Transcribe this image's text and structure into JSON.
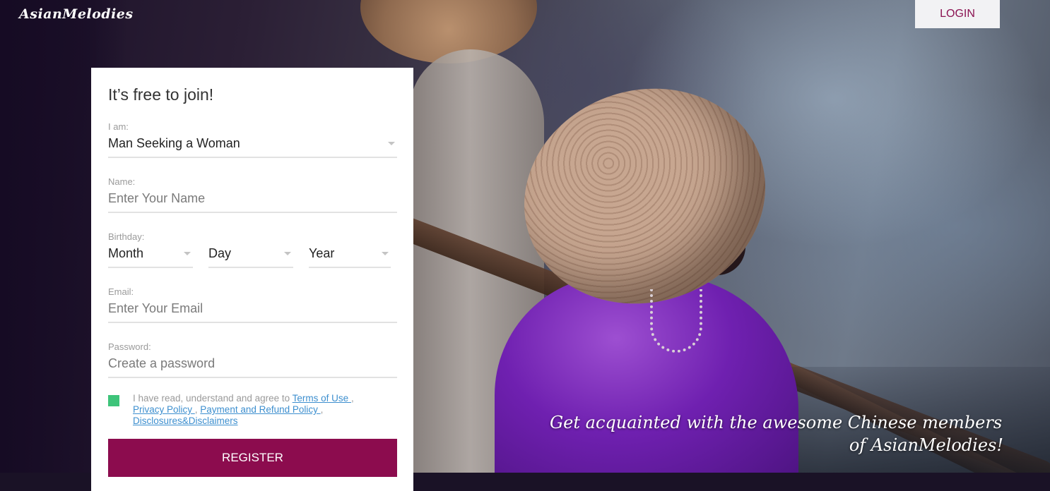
{
  "header": {
    "logo": "AsianMelodies",
    "login_label": "LOGIN"
  },
  "form": {
    "title": "It’s free to join!",
    "iam": {
      "label": "I am:",
      "value": "Man Seeking a Woman"
    },
    "name": {
      "label": "Name:",
      "placeholder": "Enter Your Name"
    },
    "birthday": {
      "label": "Birthday:",
      "month": "Month",
      "day": "Day",
      "year": "Year"
    },
    "email": {
      "label": "Email:",
      "placeholder": "Enter Your Email"
    },
    "password": {
      "label": "Password:",
      "placeholder": "Create a password"
    },
    "agree": {
      "text": "I have read, understand and agree to ",
      "terms": "Terms of Use ",
      "privacy": "Privacy Policy ",
      "refund": "Payment and Refund Policy ",
      "disclosures": "Disclosures&Disclaimers "
    },
    "register_label": "REGISTER"
  },
  "tagline": {
    "line1": "Get acquainted with the awesome Chinese members",
    "line2": "of AsianMelodies!"
  },
  "colors": {
    "brand": "#8c0c4e",
    "checkbox": "#3ec47a",
    "link": "#3d8fcf"
  }
}
